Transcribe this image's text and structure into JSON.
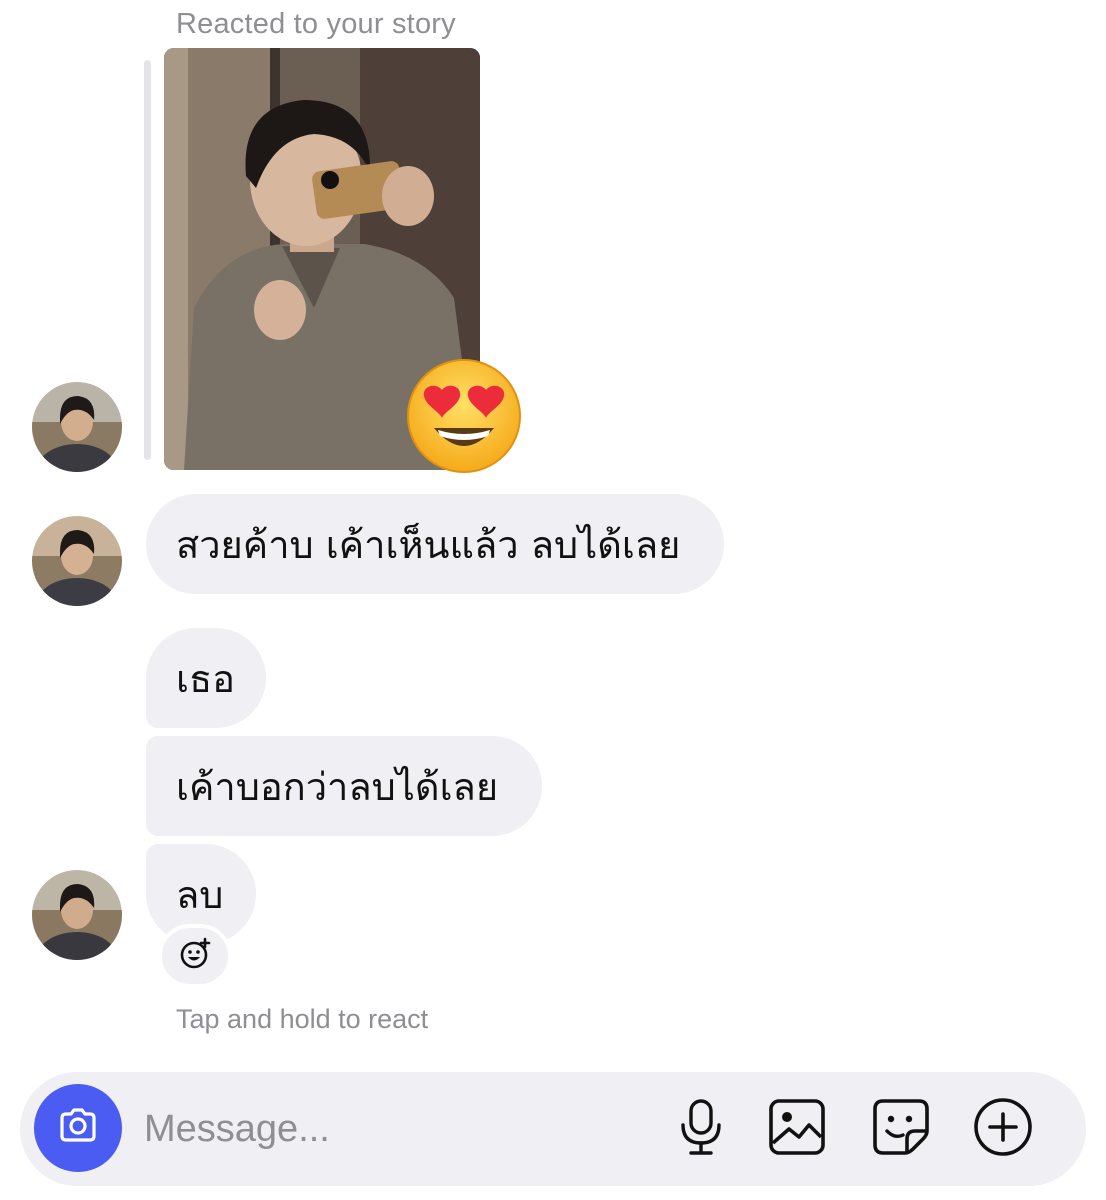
{
  "thread": {
    "story_reaction_label": "Reacted to your story",
    "reaction_emoji": "heart-eyes-emoji",
    "messages": [
      {
        "text": "สวยค้าบ เค้าเห็นแล้ว ลบได้เลย"
      },
      {
        "text": "เธอ"
      },
      {
        "text": "เค้าบอกว่าลบได้เลย"
      },
      {
        "text": "ลบ"
      }
    ],
    "react_hint": "Tap and hold to react"
  },
  "composer": {
    "placeholder": "Message...",
    "accent_color": "#4a5cf1"
  }
}
